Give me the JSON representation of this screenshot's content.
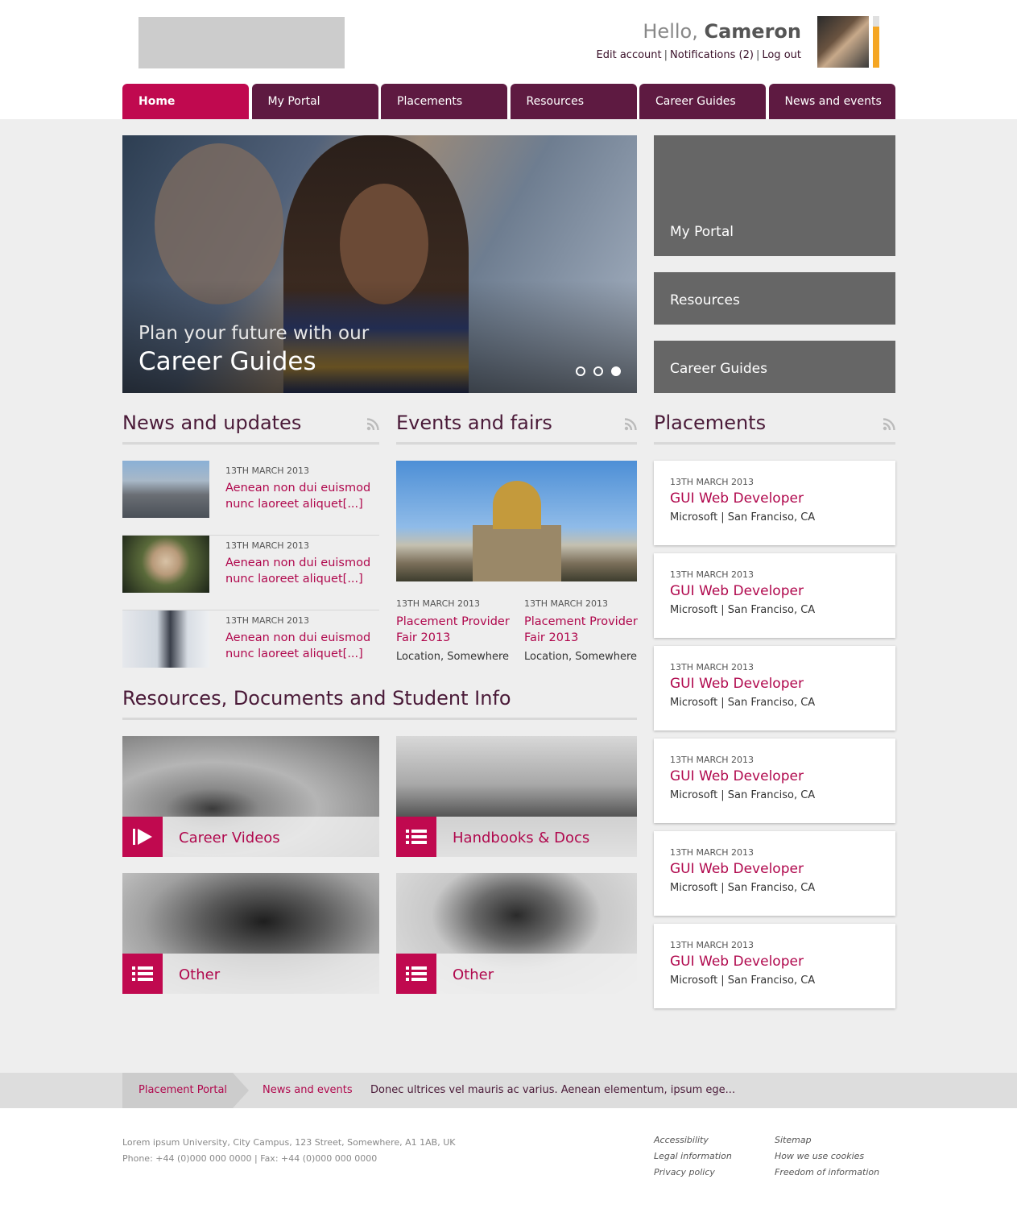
{
  "header": {
    "greeting_prefix": "Hello,",
    "user_name": "Cameron",
    "links": [
      "Edit account",
      "Notifications (2)",
      "Log out"
    ],
    "separator": "|"
  },
  "nav": {
    "tabs": [
      "Home",
      "My Portal",
      "Placements",
      "Resources",
      "Career Guides",
      "News and events"
    ],
    "active_tab": "Home"
  },
  "hero": {
    "line1": "Plan your future with our",
    "line2": "Career Guides",
    "slide_count": 3,
    "active_slide": 3
  },
  "side_tiles": [
    "My Portal",
    "Resources",
    "Career Guides"
  ],
  "news": {
    "title": "News and updates",
    "items": [
      {
        "date": "13TH MARCH 2013",
        "title": "Aenean non dui euismod nunc laoreet aliquet[...]"
      },
      {
        "date": "13TH MARCH 2013",
        "title": "Aenean non dui euismod nunc laoreet aliquet[...]"
      },
      {
        "date": "13TH MARCH 2013",
        "title": "Aenean non dui euismod nunc laoreet aliquet[...]"
      }
    ]
  },
  "events": {
    "title": "Events and fairs",
    "items": [
      {
        "date": "13TH MARCH 2013",
        "title": "Placement Provider Fair 2013",
        "location": "Location, Somewhere"
      },
      {
        "date": "13TH MARCH 2013",
        "title": "Placement Provider Fair 2013",
        "location": "Location, Somewhere"
      }
    ]
  },
  "placements": {
    "title": "Placements",
    "items": [
      {
        "date": "13TH MARCH 2013",
        "title": "GUI Web Developer",
        "company": "Microsoft | San Franciso, CA"
      },
      {
        "date": "13TH MARCH 2013",
        "title": "GUI Web Developer",
        "company": "Microsoft | San Franciso, CA"
      },
      {
        "date": "13TH MARCH 2013",
        "title": "GUI Web Developer",
        "company": "Microsoft | San Franciso, CA"
      },
      {
        "date": "13TH MARCH 2013",
        "title": "GUI Web Developer",
        "company": "Microsoft | San Franciso, CA"
      },
      {
        "date": "13TH MARCH 2013",
        "title": "GUI Web Developer",
        "company": "Microsoft | San Franciso, CA"
      },
      {
        "date": "13TH MARCH 2013",
        "title": "GUI Web Developer",
        "company": "Microsoft | San Franciso, CA"
      }
    ]
  },
  "resources": {
    "title": "Resources, Documents and Student Info",
    "tiles": [
      {
        "label": "Career Videos",
        "icon": "play-icon"
      },
      {
        "label": "Handbooks & Docs",
        "icon": "list-icon"
      },
      {
        "label": "Other",
        "icon": "list-icon"
      },
      {
        "label": "Other",
        "icon": "list-icon"
      }
    ]
  },
  "breadcrumb": {
    "items": [
      "Placement Portal",
      "News and events"
    ],
    "ticker": "Donec ultrices vel mauris ac varius. Aenean elementum, ipsum ege..."
  },
  "footer": {
    "address": "Lorem ipsum University, City Campus, 123 Street, Somewhere, A1 1AB, UK",
    "phone": "Phone: +44 (0)000 000 0000 | Fax: +44 (0)000 000 0000",
    "links_col1": [
      "Accessibility",
      "Legal information",
      "Privacy policy"
    ],
    "links_col2": [
      "Sitemap",
      "How we use cookies",
      "Freedom of information"
    ]
  },
  "colors": {
    "brand": "#5e1a41",
    "accent": "#c0094f",
    "notification": "#f5a623"
  },
  "notification_level": 0.8
}
